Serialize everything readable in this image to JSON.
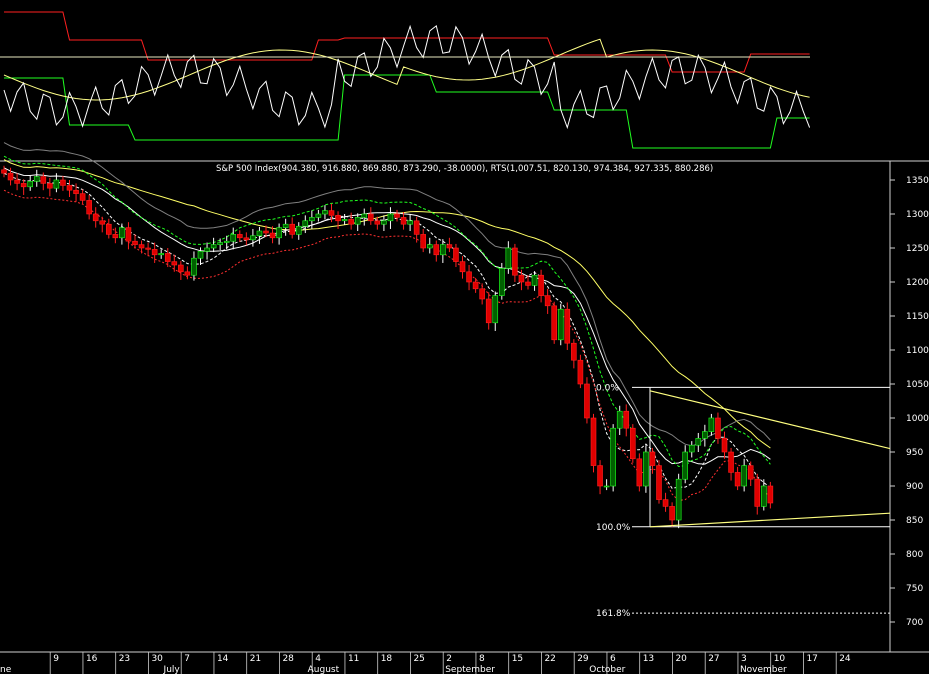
{
  "chart_data": {
    "type": "candlestick",
    "title": "S&P 500 Index(904.380, 916.880, 869.880, 873.290, -38.0000), RTS(1,007.51, 820.130, 974.384, 927.335, 880.286)",
    "ylim": [
      650,
      1375
    ],
    "yticks": [
      1350,
      1300,
      1250,
      1200,
      1150,
      1100,
      1050,
      1000,
      950,
      900,
      850,
      800,
      750,
      700
    ],
    "xticks": [
      {
        "i": 4,
        "label": "9"
      },
      {
        "i": 9,
        "label": "16"
      },
      {
        "i": 14,
        "label": "23"
      },
      {
        "i": 19,
        "label": "30"
      },
      {
        "i": 24,
        "label": "7"
      },
      {
        "i": 29,
        "label": "14"
      },
      {
        "i": 34,
        "label": "21"
      },
      {
        "i": 39,
        "label": "28"
      },
      {
        "i": 44,
        "label": "4"
      },
      {
        "i": 49,
        "label": "11"
      },
      {
        "i": 54,
        "label": "18"
      },
      {
        "i": 59,
        "label": "25"
      },
      {
        "i": 64,
        "label": "2"
      },
      {
        "i": 69,
        "label": "8"
      },
      {
        "i": 74,
        "label": "15"
      },
      {
        "i": 79,
        "label": "22"
      },
      {
        "i": 84,
        "label": "29"
      },
      {
        "i": 89,
        "label": "6"
      },
      {
        "i": 94,
        "label": "13"
      },
      {
        "i": 99,
        "label": "20"
      },
      {
        "i": 104,
        "label": "27"
      },
      {
        "i": 109,
        "label": "3"
      },
      {
        "i": 114,
        "label": "10"
      },
      {
        "i": 119,
        "label": "17"
      },
      {
        "i": 124,
        "label": "24"
      }
    ],
    "months": [
      {
        "i": 0,
        "label": "ne"
      },
      {
        "i": 21,
        "label": "July"
      },
      {
        "i": 43,
        "label": "August"
      },
      {
        "i": 64,
        "label": "September"
      },
      {
        "i": 86,
        "label": "October"
      },
      {
        "i": 109,
        "label": "November"
      }
    ],
    "fib_levels": [
      {
        "label": "0.0%",
        "value": 1045
      },
      {
        "label": "100.0%",
        "value": 840
      },
      {
        "label": "161.8%",
        "value": 713
      }
    ],
    "closes": [
      1360,
      1350,
      1345,
      1340,
      1348,
      1355,
      1345,
      1338,
      1350,
      1342,
      1335,
      1330,
      1320,
      1300,
      1290,
      1285,
      1270,
      1265,
      1280,
      1260,
      1255,
      1250,
      1248,
      1240,
      1242,
      1230,
      1225,
      1215,
      1210,
      1235,
      1245,
      1250,
      1255,
      1258,
      1260,
      1270,
      1265,
      1262,
      1268,
      1275,
      1272,
      1265,
      1280,
      1285,
      1270,
      1282,
      1290,
      1295,
      1300,
      1305,
      1298,
      1290,
      1292,
      1285,
      1295,
      1300,
      1290,
      1285,
      1290,
      1300,
      1295,
      1285,
      1290,
      1270,
      1250,
      1255,
      1240,
      1255,
      1250,
      1230,
      1215,
      1200,
      1190,
      1175,
      1140,
      1180,
      1220,
      1250,
      1210,
      1200,
      1195,
      1210,
      1180,
      1165,
      1115,
      1160,
      1110,
      1085,
      1050,
      1000,
      930,
      900,
      900,
      985,
      1010,
      985,
      940,
      900,
      950,
      930,
      880,
      870,
      850,
      910,
      950,
      960,
      970,
      980,
      1000,
      970,
      950,
      920,
      900,
      930,
      910,
      870,
      900,
      875
    ],
    "upper_panel": {
      "type": "line",
      "series_count": 4
    }
  }
}
